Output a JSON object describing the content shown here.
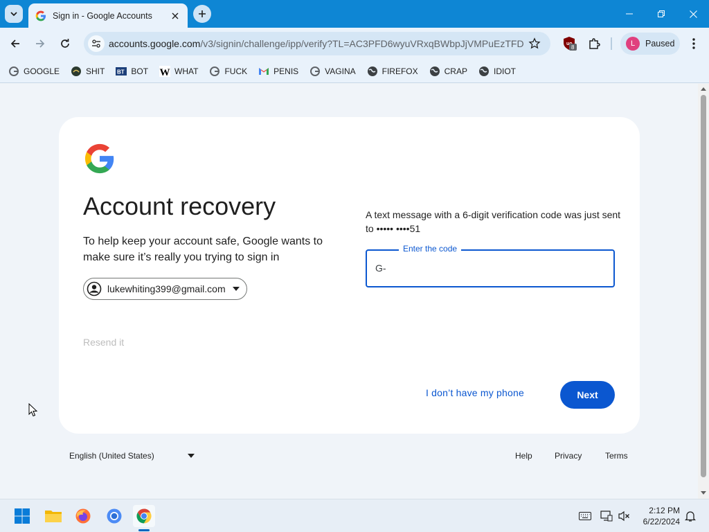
{
  "browser": {
    "tab_title": "Sign in - Google Accounts",
    "url_host": "accounts.google.com",
    "url_path": "/v3/signin/challenge/ipp/verify?TL=AC3PFD6wyuVRxqBWbpJjVMPuEzTFD...",
    "profile_initial": "L",
    "profile_status": "Paused",
    "extension_badge": "8"
  },
  "bookmarks": [
    {
      "label": "GOOGLE",
      "icon": "google-g-icon"
    },
    {
      "label": "SHIT",
      "icon": "site-icon"
    },
    {
      "label": "BOT",
      "icon": "bt-icon"
    },
    {
      "label": "WHAT",
      "icon": "w-icon"
    },
    {
      "label": "FUCK",
      "icon": "google-g-icon"
    },
    {
      "label": "PENIS",
      "icon": "gmail-icon"
    },
    {
      "label": "VAGINA",
      "icon": "google-g-icon"
    },
    {
      "label": "FIREFOX",
      "icon": "globe-icon"
    },
    {
      "label": "CRAP",
      "icon": "globe-icon"
    },
    {
      "label": "IDIOT",
      "icon": "globe-icon"
    }
  ],
  "card": {
    "title": "Account recovery",
    "description": "To help keep your account safe, Google wants to make sure it’s really you trying to sign in",
    "account_email": "lukewhiting399@gmail.com",
    "resend_label": "Resend it",
    "message": "A text message with a 6-digit verification code was just sent to ••••• ••••51",
    "code_label": "Enter the code",
    "code_value": "G-",
    "no_phone_label": "I don’t have my phone",
    "next_label": "Next"
  },
  "footer": {
    "language": "English (United States)",
    "help": "Help",
    "privacy": "Privacy",
    "terms": "Terms"
  },
  "taskbar": {
    "time": "2:12 PM",
    "date": "6/22/2024"
  },
  "colors": {
    "accent_blue": "#0b57d0",
    "titlebar": "#0e86d4",
    "page_bg": "#f0f4f9"
  }
}
